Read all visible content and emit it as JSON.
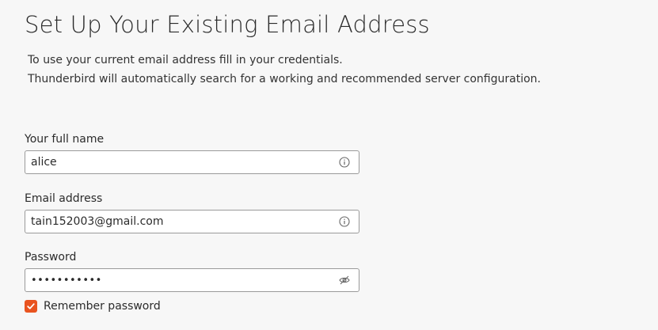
{
  "page": {
    "title": "Set Up Your Existing Email Address",
    "intro_line1": "To use your current email address fill in your credentials.",
    "intro_line2": "Thunderbird will automatically search for a working and recommended server configuration."
  },
  "form": {
    "full_name": {
      "label": "Your full name",
      "value": "alice",
      "icon": "info-icon"
    },
    "email": {
      "label": "Email address",
      "value": "tain152003@gmail.com",
      "icon": "info-icon"
    },
    "password": {
      "label": "Password",
      "value": "•••••••••••",
      "icon": "eye-slash-icon"
    },
    "remember": {
      "label": "Remember password",
      "checked": true
    }
  },
  "colors": {
    "accent": "#e95420",
    "background": "#f7f7f7",
    "input_border": "#9a9a9a"
  }
}
